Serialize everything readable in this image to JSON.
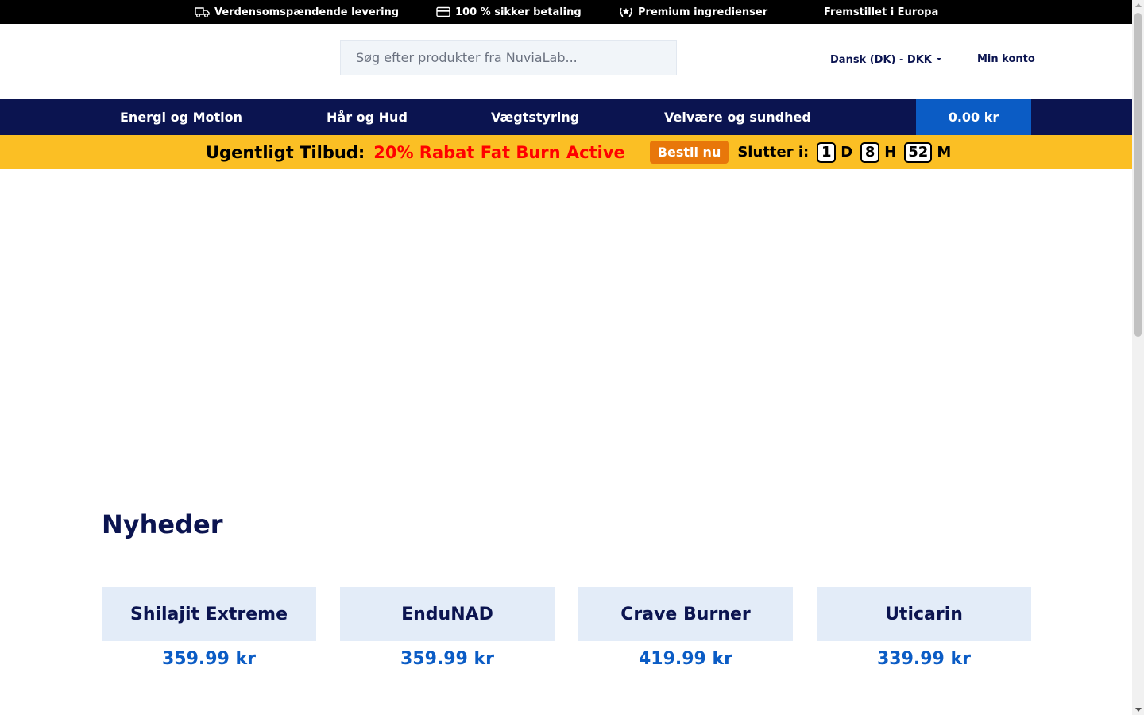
{
  "topbar": {
    "items": [
      {
        "icon": "truck-icon",
        "label": "Verdensomspændende levering"
      },
      {
        "icon": "credit-card-icon",
        "label": "100 % sikker betaling"
      },
      {
        "icon": "laurel-icon",
        "label": "Premium ingredienser"
      },
      {
        "icon": "",
        "label": "Fremstillet i Europa"
      }
    ]
  },
  "header": {
    "search_placeholder": "Søg efter produkter fra NuviaLab...",
    "language": "Dansk (DK) - DKK",
    "account": "Min konto"
  },
  "nav": {
    "items": [
      "Energi og Motion",
      "Hår og Hud",
      "Vægtstyring",
      "Velvære og sundhed"
    ],
    "cart_total": "0.00 kr"
  },
  "promo": {
    "label": "Ugentligt Tilbud:",
    "offer": "20% Rabat Fat Burn Active",
    "button": "Bestil nu",
    "ends_label": "Slutter i:",
    "days": "1",
    "days_unit": "D",
    "hours": "8",
    "hours_unit": "H",
    "minutes": "52",
    "minutes_unit": "M"
  },
  "new_arrivals": {
    "title": "Nyheder",
    "products": [
      {
        "name": "Shilajit Extreme",
        "price": "359.99 kr"
      },
      {
        "name": "EnduNAD",
        "price": "359.99 kr"
      },
      {
        "name": "Crave Burner",
        "price": "419.99 kr"
      },
      {
        "name": "Uticarin",
        "price": "339.99 kr"
      }
    ]
  },
  "colors": {
    "navy": "#0b1450",
    "accent_blue": "#0b5cc5",
    "promo_yellow": "#fbbf24",
    "promo_red": "#ff0000",
    "button_orange": "#e8770a"
  }
}
